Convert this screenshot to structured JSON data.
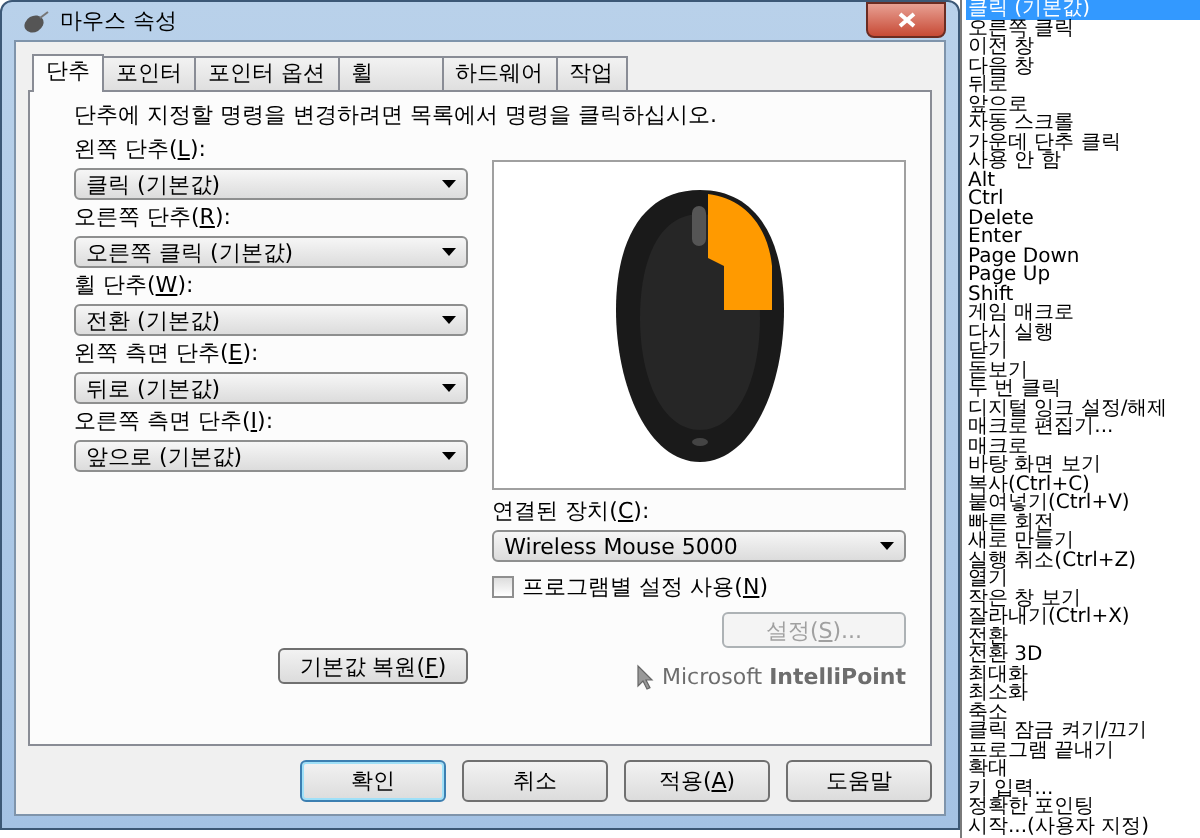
{
  "window": {
    "title": "마우스 속성"
  },
  "tabs": [
    {
      "label": "단추",
      "selected": true
    },
    {
      "label": "포인터",
      "selected": false
    },
    {
      "label": "포인터 옵션",
      "selected": false
    },
    {
      "label": "휠",
      "selected": false
    },
    {
      "label": "하드웨어",
      "selected": false
    },
    {
      "label": "작업",
      "selected": false
    }
  ],
  "instruction": "단추에 지정할 명령을 변경하려면 목록에서 명령을 클릭하십시오.",
  "button_fields": [
    {
      "label": {
        "pre": "왼쪽 단추(",
        "key": "L",
        "post": "):"
      },
      "value": "클릭 (기본값)"
    },
    {
      "label": {
        "pre": "오른쪽 단추(",
        "key": "R",
        "post": "):"
      },
      "value": "오른쪽 클릭 (기본값)"
    },
    {
      "label": {
        "pre": "휠 단추(",
        "key": "W",
        "post": "):"
      },
      "value": "전환 (기본값)"
    },
    {
      "label": {
        "pre": "왼쪽 측면 단추(",
        "key": "E",
        "post": "):"
      },
      "value": "뒤로 (기본값)"
    },
    {
      "label": {
        "pre": "오른쪽 측면 단추(",
        "key": "I",
        "post": "):"
      },
      "value": "앞으로 (기본값)"
    }
  ],
  "restore_button": {
    "pre": "기본값 복원(",
    "key": "F",
    "post": ")"
  },
  "connected_device": {
    "label": {
      "pre": "연결된 장치(",
      "key": "C",
      "post": "):"
    },
    "value": "Wireless Mouse 5000"
  },
  "per_program_checkbox": {
    "label": {
      "pre": "프로그램별 설정 사용(",
      "key": "N",
      "post": ")"
    },
    "checked": false
  },
  "settings_button": {
    "label": {
      "pre": "설정(",
      "key": "S",
      "post": ")..."
    },
    "disabled": true
  },
  "brand": "Microsoft **IntelliPoint**",
  "dialog_buttons": [
    {
      "label": {
        "pre": "확인"
      },
      "default": true
    },
    {
      "label": {
        "pre": "취소"
      },
      "default": false
    },
    {
      "label": {
        "pre": "적용(",
        "key": "A",
        "post": ")"
      },
      "default": false
    },
    {
      "label": {
        "pre": "도움말"
      },
      "default": false
    }
  ],
  "command_list": [
    {
      "label": "클릭 (기본값)",
      "selected": true
    },
    {
      "label": "오른쪽 클릭",
      "selected": false
    },
    {
      "label": "이전 창",
      "selected": false
    },
    {
      "label": "다음 창",
      "selected": false
    },
    {
      "label": "뒤로",
      "selected": false
    },
    {
      "label": "앞으로",
      "selected": false
    },
    {
      "label": "자동 스크롤",
      "selected": false
    },
    {
      "label": "가운데 단추 클릭",
      "selected": false
    },
    {
      "label": "사용 안 함",
      "selected": false
    },
    {
      "label": "Alt",
      "selected": false
    },
    {
      "label": "Ctrl",
      "selected": false
    },
    {
      "label": "Delete",
      "selected": false
    },
    {
      "label": "Enter",
      "selected": false
    },
    {
      "label": "Page Down",
      "selected": false
    },
    {
      "label": "Page Up",
      "selected": false
    },
    {
      "label": "Shift",
      "selected": false
    },
    {
      "label": "게임 매크로",
      "selected": false
    },
    {
      "label": "다시 실행",
      "selected": false
    },
    {
      "label": "닫기",
      "selected": false
    },
    {
      "label": "돋보기",
      "selected": false
    },
    {
      "label": "두 번 클릭",
      "selected": false
    },
    {
      "label": "디지털 잉크 설정/해제",
      "selected": false
    },
    {
      "label": "매크로 편집기...",
      "selected": false
    },
    {
      "label": "매크로",
      "selected": false
    },
    {
      "label": "바탕 화면 보기",
      "selected": false
    },
    {
      "label": "복사(Ctrl+C)",
      "selected": false
    },
    {
      "label": "붙여넣기(Ctrl+V)",
      "selected": false
    },
    {
      "label": "빠른 회전",
      "selected": false
    },
    {
      "label": "새로 만들기",
      "selected": false
    },
    {
      "label": "실행 취소(Ctrl+Z)",
      "selected": false
    },
    {
      "label": "열기",
      "selected": false
    },
    {
      "label": "작은 창 보기",
      "selected": false
    },
    {
      "label": "잘라내기(Ctrl+X)",
      "selected": false
    },
    {
      "label": "전환",
      "selected": false
    },
    {
      "label": "전환 3D",
      "selected": false
    },
    {
      "label": "최대화",
      "selected": false
    },
    {
      "label": "최소화",
      "selected": false
    },
    {
      "label": "축소",
      "selected": false
    },
    {
      "label": "클릭 잠금 켜기/끄기",
      "selected": false
    },
    {
      "label": "프로그램 끝내기",
      "selected": false
    },
    {
      "label": "확대",
      "selected": false
    },
    {
      "label": "키 입력...",
      "selected": false
    },
    {
      "label": "정확한 포인팅",
      "selected": false
    },
    {
      "label": "시작...(사용자 지정)",
      "selected": false
    }
  ]
}
